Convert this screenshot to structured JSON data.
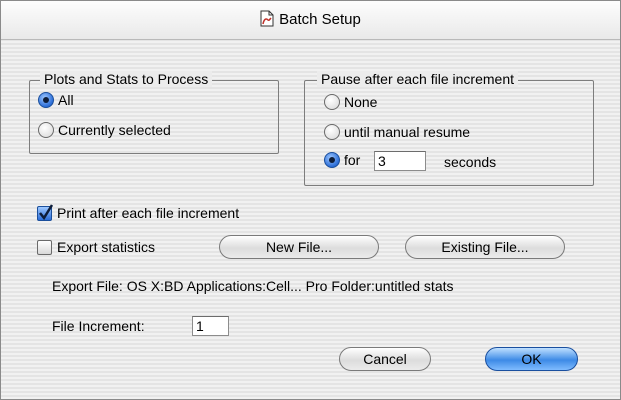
{
  "window": {
    "title": "Batch Setup"
  },
  "plots_group": {
    "title": "Plots and Stats to Process",
    "options": [
      {
        "label": "All",
        "selected": true
      },
      {
        "label": "Currently selected",
        "selected": false
      }
    ]
  },
  "pause_group": {
    "title": "Pause after each file increment",
    "options": [
      {
        "label": "None",
        "selected": false
      },
      {
        "label": "until manual resume",
        "selected": false
      },
      {
        "label": "for",
        "selected": true
      }
    ],
    "seconds_value": "3",
    "seconds_label": "seconds"
  },
  "print_after": {
    "label": "Print after each file increment",
    "checked": true
  },
  "export_stats": {
    "label": "Export statistics",
    "checked": false
  },
  "buttons": {
    "new_file": "New File...",
    "existing_file": "Existing File...",
    "cancel": "Cancel",
    "ok": "OK"
  },
  "export_file": {
    "text": "Export File: OS X:BD Applications:Cell... Pro Folder:untitled stats"
  },
  "file_increment": {
    "label": "File Increment:",
    "value": "1"
  },
  "colors": {
    "accent": "#2c6ed8",
    "default_button": "#3d8ae6"
  }
}
